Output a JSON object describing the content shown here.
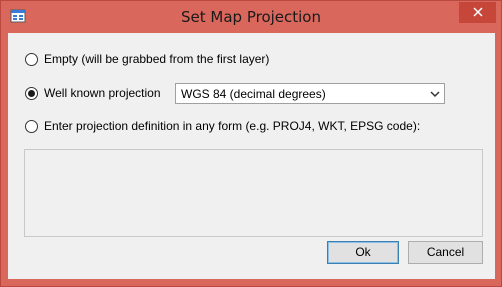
{
  "window": {
    "title": "Set Map Projection",
    "frame_color": "#d9675c"
  },
  "icons": {
    "app": "window-icon",
    "close": "close-icon",
    "dropdown": "chevron-down-icon"
  },
  "options": {
    "empty": {
      "label": "Empty (will be grabbed from the first layer)",
      "selected": false
    },
    "well_known": {
      "label": "Well known projection",
      "selected": true
    },
    "custom": {
      "label": "Enter projection definition in any form (e.g. PROJ4, WKT, EPSG code):",
      "selected": false
    }
  },
  "projection_select": {
    "value": "WGS 84 (decimal degrees)"
  },
  "definition_input": {
    "value": ""
  },
  "buttons": {
    "ok": "Ok",
    "cancel": "Cancel"
  }
}
